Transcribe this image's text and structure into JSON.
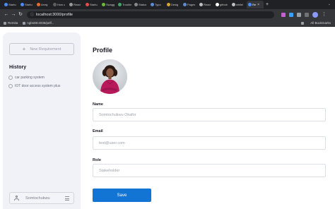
{
  "browser": {
    "tabs": [
      {
        "label": "Startu",
        "color": "#4a8cff",
        "active": false
      },
      {
        "label": "Startu",
        "color": "#4a8cff",
        "active": false
      },
      {
        "label": "Array",
        "color": "#e86b2a",
        "active": false
      },
      {
        "label": "How c",
        "color": "#5e5e5e",
        "active": false
      },
      {
        "label": "React",
        "color": "#9a9a9a",
        "active": false
      },
      {
        "label": "Startu",
        "color": "#e64c4c",
        "active": false
      },
      {
        "label": "Swagg",
        "color": "#6dbb3a",
        "active": false
      },
      {
        "label": "Trouble",
        "color": "#44a46a",
        "active": false
      },
      {
        "label": "Status",
        "color": "#8a8a8a",
        "active": false
      },
      {
        "label": "Typo",
        "color": "#5b8dd6",
        "active": false
      },
      {
        "label": "Desig",
        "color": "#d9a72b",
        "active": false
      },
      {
        "label": "Pages",
        "color": "#5b8dd6",
        "active": false
      },
      {
        "label": "React",
        "color": "#c0c0c0",
        "active": false
      },
      {
        "label": "github",
        "color": "#ffffff",
        "active": false
      },
      {
        "label": "whilel",
        "color": "#c0c0c0",
        "active": false
      },
      {
        "label": "Re",
        "color": "#4a8cff",
        "active": true
      }
    ],
    "url": "localhost:3000/profile",
    "bookmarks": [
      {
        "label": "Remita"
      },
      {
        "label": "ngbs08:4036/pelf..."
      }
    ],
    "all_bookmarks_label": "All Bookmarks"
  },
  "sidebar": {
    "new_requirement_label": "New Requirement",
    "history_title": "History",
    "history_items": [
      {
        "label": "car parking system"
      },
      {
        "label": "IOT door access system plus"
      }
    ],
    "user_name": "Somtochukwu"
  },
  "profile": {
    "title": "Profile",
    "name_label": "Name",
    "name_value": "Somtochukwu Okafor",
    "email_label": "Email",
    "email_value": "test@user.com",
    "role_label": "Role",
    "role_value": "Stakeholder",
    "save_label": "Save"
  },
  "colors": {
    "primary_button": "#1275d4",
    "sidebar_bg": "#f0f2f8"
  }
}
